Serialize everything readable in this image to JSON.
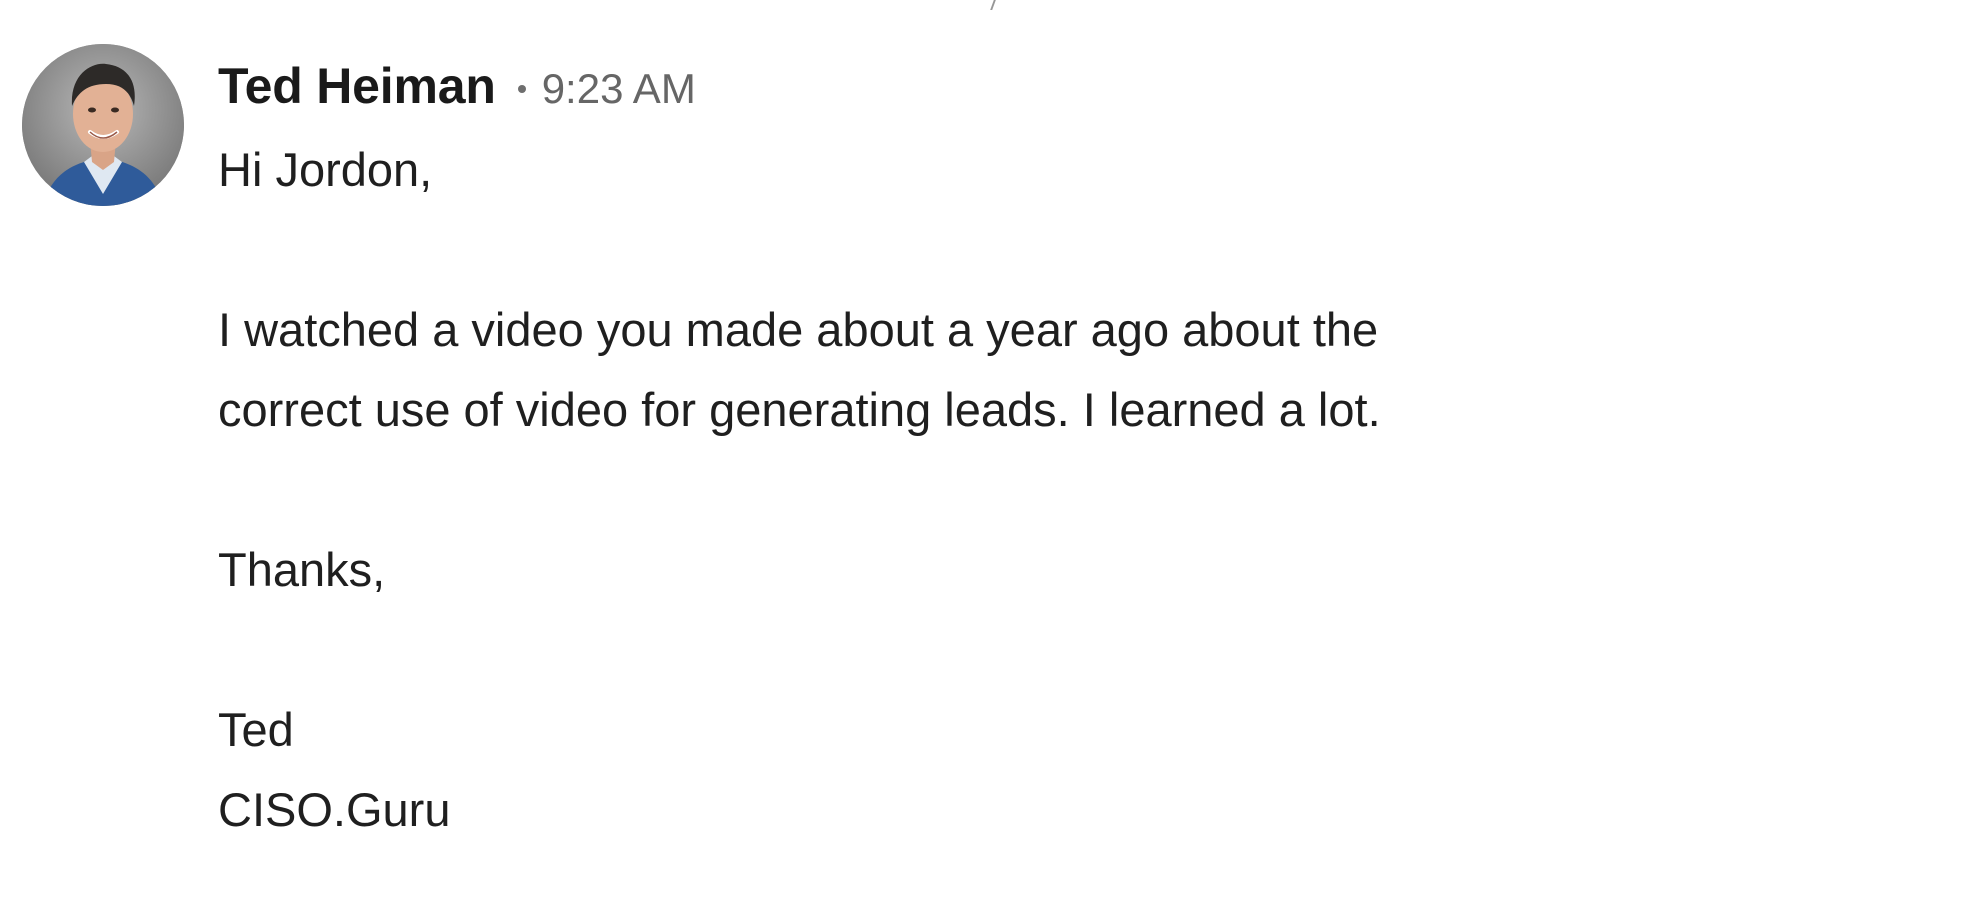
{
  "message": {
    "sender": "Ted Heiman",
    "time": "9:23 AM",
    "avatar_icon": "person-photo-avatar",
    "body": {
      "greeting": "Hi Jordon,",
      "paragraph_line1": "I watched a video you made about a year ago about the",
      "paragraph_line2": "correct use of video for generating leads. I learned a lot.",
      "closing": "Thanks,",
      "signature_name": "Ted",
      "signature_company": "CISO.Guru"
    }
  },
  "colors": {
    "text": "#1f1f1f",
    "muted": "#666666",
    "avatar_bg": "#8e8e8e",
    "suit": "#2f5b9a"
  }
}
